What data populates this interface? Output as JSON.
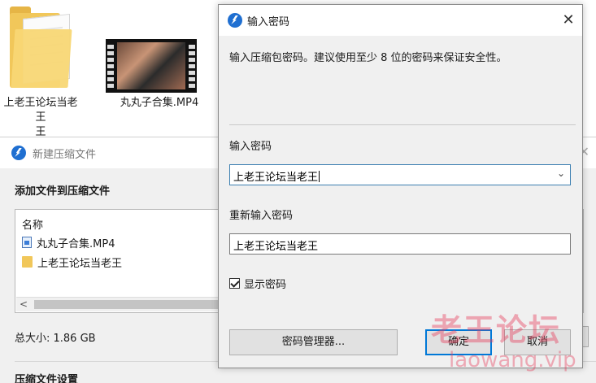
{
  "desktop": {
    "folder": {
      "label": "上老王论坛当老王",
      "label_line2": "王"
    },
    "video": {
      "label": "丸丸子合集.MP4"
    }
  },
  "background_dialog": {
    "title": "新建压缩文件",
    "heading": "添加文件到压缩文件",
    "list_header": "名称",
    "files": [
      {
        "name": "丸丸子合集.MP4",
        "icon": "video-file-icon"
      },
      {
        "name": "上老王论坛当老王",
        "icon": "folder-icon"
      }
    ],
    "edge_text": [
      "叵",
      "叵"
    ],
    "total_size_label": "总大小: 1.86 GB",
    "section_label": "压缩文件设置"
  },
  "password_dialog": {
    "title": "输入密码",
    "description": "输入压缩包密码。建议使用至少 8 位的密码来保证安全性。",
    "password_label": "输入密码",
    "password_value": "上老王论坛当老王",
    "confirm_label": "重新输入密码",
    "confirm_value": "上老王论坛当老王",
    "show_password_label": "显示密码",
    "show_password_checked": true,
    "buttons": {
      "manager": "密码管理器...",
      "ok": "确定",
      "cancel": "取消"
    },
    "close_glyph": "✕",
    "combo_arrow_glyph": "⌄"
  },
  "watermark": {
    "text_cn": "老王论坛",
    "text_en": "laowang.vip"
  },
  "colors": {
    "accent_blue": "#0078d7",
    "app_logo": "#1f6fd1",
    "watermark": "#e63c5a"
  }
}
